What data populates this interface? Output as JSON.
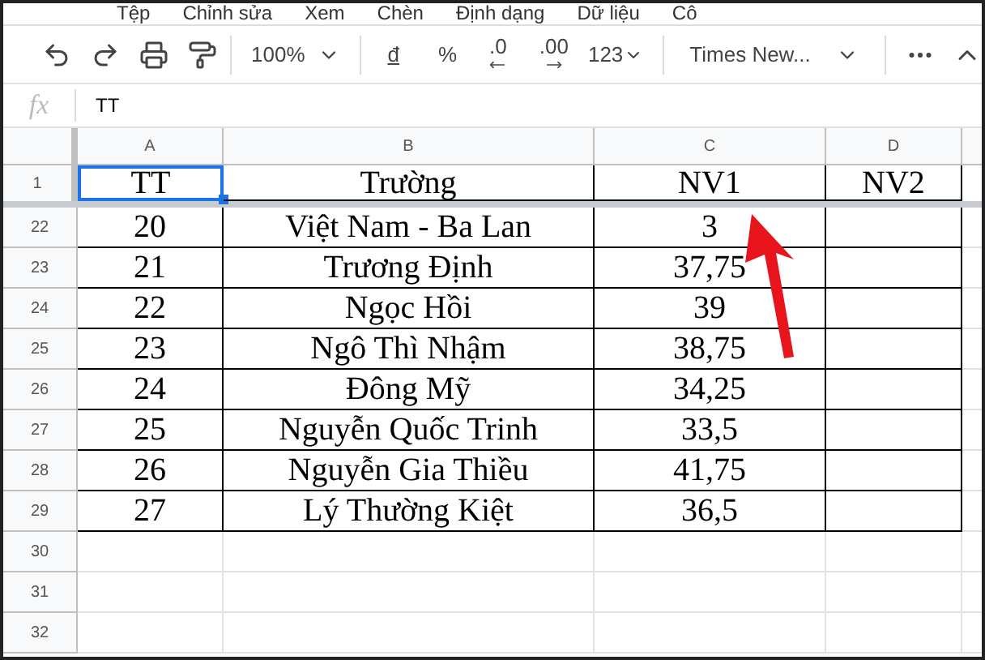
{
  "menu": [
    "Tệp",
    "Chỉnh sửa",
    "Xem",
    "Chèn",
    "Định dạng",
    "Dữ liệu",
    "Cô"
  ],
  "toolbar": {
    "zoom": "100%",
    "currency": "đ",
    "percent": "%",
    "decrease_decimals": ".0",
    "increase_decimals": ".00",
    "number_format": "123",
    "font": "Times New..."
  },
  "formula_bar": {
    "label": "fx",
    "value": "TT"
  },
  "columns": [
    "A",
    "B",
    "C",
    "D"
  ],
  "header_row": {
    "number": "1",
    "cells": [
      {
        "text": "TT",
        "selected": true
      },
      {
        "text": "Trường",
        "selected": false
      },
      {
        "text": "NV1",
        "selected": false
      },
      {
        "text": "NV2",
        "selected": false
      }
    ]
  },
  "rows": [
    {
      "number": "22",
      "cells": [
        "20",
        "Việt Nam - Ba Lan",
        "3",
        ""
      ]
    },
    {
      "number": "23",
      "cells": [
        "21",
        "Trương Định",
        "37,75",
        ""
      ]
    },
    {
      "number": "24",
      "cells": [
        "22",
        "Ngọc Hồi",
        "39",
        ""
      ]
    },
    {
      "number": "25",
      "cells": [
        "23",
        "Ngô Thì Nhậm",
        "38,75",
        ""
      ]
    },
    {
      "number": "26",
      "cells": [
        "24",
        "Đông Mỹ",
        "34,25",
        ""
      ]
    },
    {
      "number": "27",
      "cells": [
        "25",
        "Nguyễn Quốc Trinh",
        "33,5",
        ""
      ]
    },
    {
      "number": "28",
      "cells": [
        "26",
        "Nguyễn Gia Thiều",
        "41,75",
        ""
      ]
    },
    {
      "number": "29",
      "cells": [
        "27",
        "Lý Thường Kiệt",
        "36,5",
        ""
      ]
    }
  ],
  "empty_rows": [
    "30",
    "31",
    "32"
  ]
}
